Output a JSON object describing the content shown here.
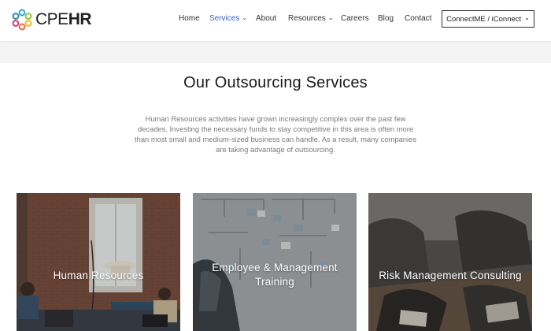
{
  "header": {
    "logo": {
      "text_a": "CPE",
      "text_b": "HR"
    },
    "nav": [
      {
        "label": "Home",
        "active": false,
        "has_dropdown": false
      },
      {
        "label": "Services",
        "active": true,
        "has_dropdown": true
      },
      {
        "label": "About",
        "active": false,
        "has_dropdown": false
      },
      {
        "label": "Resources",
        "active": false,
        "has_dropdown": true
      },
      {
        "label": "Careers",
        "active": false,
        "has_dropdown": false
      },
      {
        "label": "Blog",
        "active": false,
        "has_dropdown": false
      },
      {
        "label": "Contact",
        "active": false,
        "has_dropdown": false
      }
    ],
    "connect_button": {
      "label": "ConnectME / iConnect",
      "icon": "chevron-down-icon"
    }
  },
  "main": {
    "title": "Our Outsourcing Services",
    "intro": "Human Resources activities have grown increasingly complex over the past few decades.  Investing the necessary funds to stay competitive in this area is often more than most small and medium-sized business can handle.  As a result, many companies are taking advantage of outsourcing.",
    "cards": [
      {
        "label": "Human Resources"
      },
      {
        "label": "Employee & Management Training"
      },
      {
        "label": "Risk Management Consulting"
      }
    ]
  },
  "colors": {
    "accent": "#3a5ec9",
    "text": "#333333",
    "muted": "#7a7a7a",
    "band": "#f4f4f4"
  }
}
